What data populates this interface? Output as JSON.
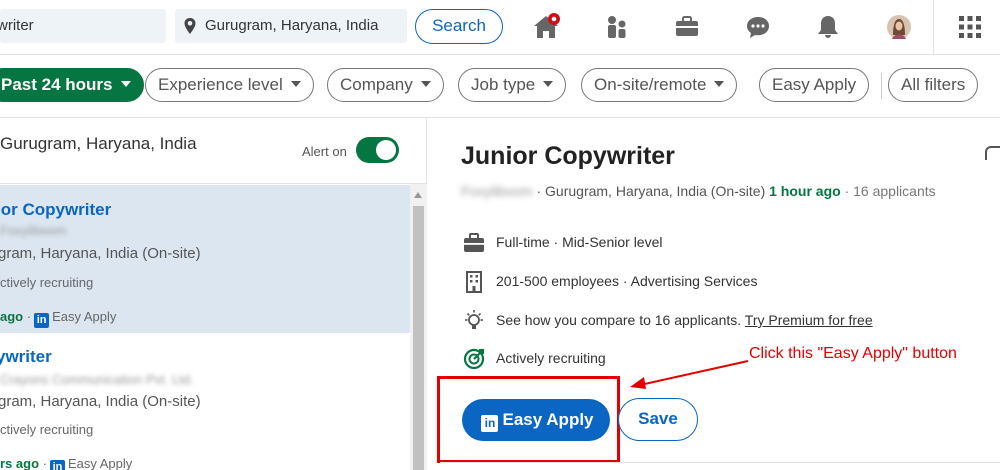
{
  "search": {
    "keyword_value": "writer",
    "location_value": "Gurugram, Haryana, India",
    "button_label": "Search"
  },
  "filters": {
    "items": [
      {
        "label": "Past 24 hours",
        "active": true
      },
      {
        "label": "Experience level"
      },
      {
        "label": "Company"
      },
      {
        "label": "Job type"
      },
      {
        "label": "On-site/remote"
      },
      {
        "label": "Easy Apply"
      },
      {
        "label": "All filters"
      }
    ]
  },
  "list": {
    "location": "Gurugram, Haryana, India",
    "alert_label": "Alert on",
    "cards": [
      {
        "title": "ior Copywriter",
        "company": "Foxyliboom",
        "place": "gram, Haryana, India (On-site)",
        "status": "ctively recruiting",
        "ago": "ago",
        "easy_apply": "Easy Apply"
      },
      {
        "title": "ywriter",
        "company": "Crayons Communication Pvt. Ltd.",
        "place": "gram, Haryana, India (On-site)",
        "status": "ctively recruiting",
        "ago": "rs ago",
        "easy_apply": "Easy Apply"
      }
    ]
  },
  "detail": {
    "title": "Junior Copywriter",
    "company": "Foxyliboom",
    "location_text": "· Gurugram, Haryana, India (On-site)",
    "posted": "1 hour ago",
    "applicants": "· 16 applicants",
    "insights": [
      {
        "icon": "briefcase-icon",
        "text": "Full-time · Mid-Senior level"
      },
      {
        "icon": "building-icon",
        "text": "201-500 employees · Advertising Services"
      },
      {
        "icon": "lightbulb-icon",
        "text": "See how you compare to 16 applicants.",
        "link": "Try Premium for free"
      },
      {
        "icon": "recruiting-target-icon",
        "text": "Actively recruiting"
      }
    ],
    "apply_label": "Easy Apply",
    "save_label": "Save"
  },
  "annotation": {
    "text": "Click this \"Easy Apply\" button",
    "color": "#e30000"
  },
  "colors": {
    "brand_blue": "#0a66c2",
    "active_green": "#057642",
    "notification_red": "#cc1016"
  }
}
